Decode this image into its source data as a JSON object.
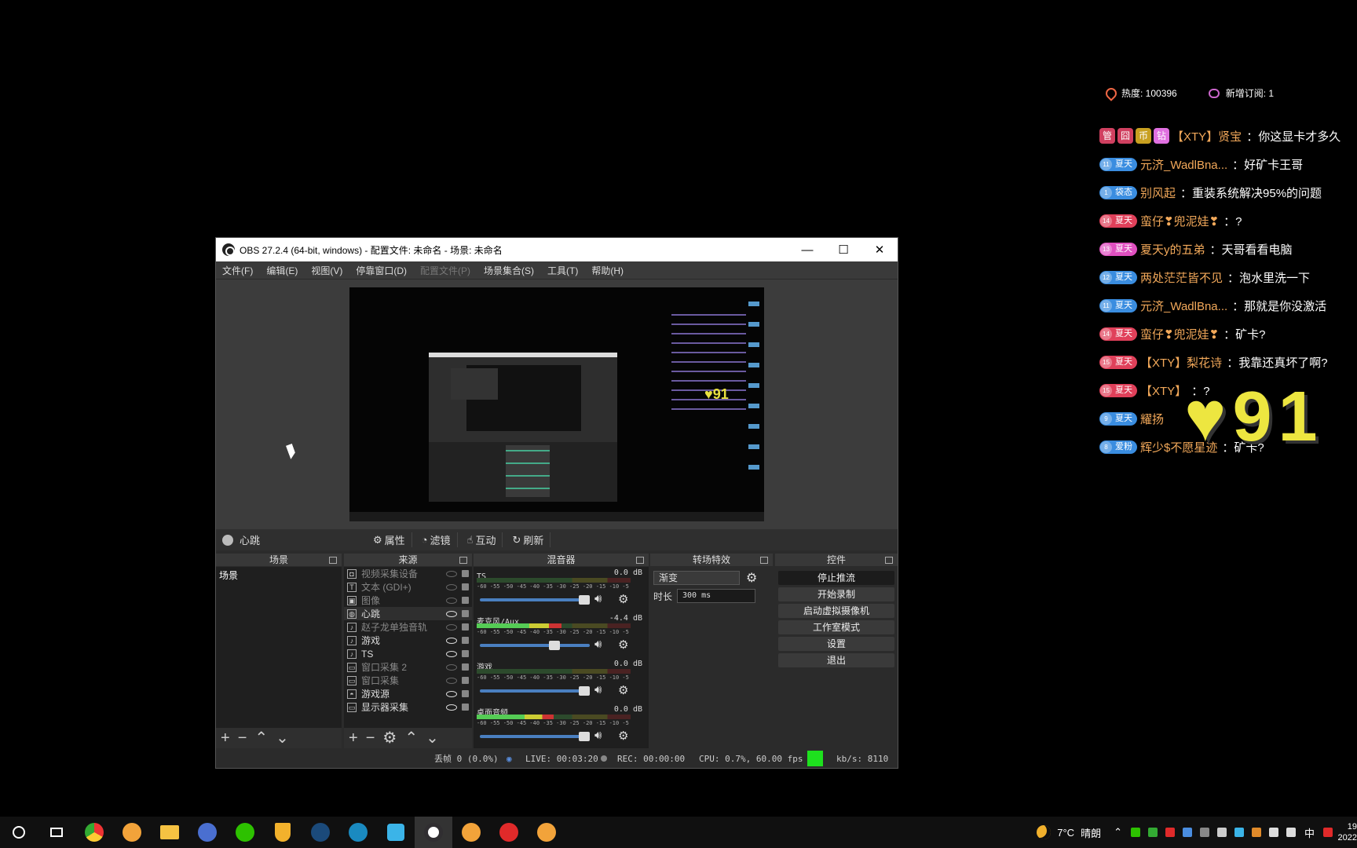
{
  "obs": {
    "title": "OBS 27.2.4 (64-bit, windows) - 配置文件: 未命名 - 场景: 未命名",
    "window_controls": {
      "minimize": "—",
      "maximize": "☐",
      "close": "✕"
    },
    "menu": [
      "文件(F)",
      "编辑(E)",
      "视图(V)",
      "停靠窗口(D)",
      "配置文件(P)",
      "场景集合(S)",
      "工具(T)",
      "帮助(H)"
    ],
    "source_bar": {
      "current_source": "心跳",
      "properties": "属性",
      "filters": "滤镜",
      "interact": "互动",
      "refresh": "刷新"
    },
    "docks": {
      "scenes": {
        "title": "场景",
        "items": [
          "场景"
        ]
      },
      "sources": {
        "title": "来源",
        "items": [
          {
            "label": "视频采集设备",
            "icon": "camera-icon",
            "visible": false
          },
          {
            "label": "文本 (GDI+)",
            "icon": "text-icon",
            "visible": false
          },
          {
            "label": "图像",
            "icon": "image-icon",
            "visible": false
          },
          {
            "label": "心跳",
            "icon": "globe-icon",
            "visible": true
          },
          {
            "label": "赵子龙单独音轨",
            "icon": "speaker-icon",
            "visible": false
          },
          {
            "label": "游戏",
            "icon": "speaker-icon",
            "visible": true
          },
          {
            "label": "TS",
            "icon": "speaker-icon",
            "visible": true
          },
          {
            "label": "窗口采集 2",
            "icon": "window-icon",
            "visible": false
          },
          {
            "label": "窗口采集",
            "icon": "window-icon",
            "visible": false
          },
          {
            "label": "游戏源",
            "icon": "gamepad-icon",
            "visible": true
          },
          {
            "label": "显示器采集",
            "icon": "monitor-icon",
            "visible": true
          }
        ]
      },
      "mixer": {
        "title": "混音器",
        "channels": [
          {
            "name": "TS",
            "db": "0.0 dB",
            "level": 0,
            "volume": 1.0
          },
          {
            "name": "麦克风/Aux",
            "db": "-4.4 dB",
            "level": 0.55,
            "volume": 0.7
          },
          {
            "name": "游戏",
            "db": "0.0 dB",
            "level": 0,
            "volume": 1.0
          },
          {
            "name": "桌面音频",
            "db": "0.0 dB",
            "level": 0.5,
            "volume": 1.0
          }
        ],
        "ticks": "-60 -55 -50 -45 -40 -35 -30 -25 -20 -15 -10 -5 0"
      },
      "transitions": {
        "title": "转场特效",
        "selected": "渐变",
        "duration_label": "时长",
        "duration_value": "300 ms"
      },
      "controls": {
        "title": "控件",
        "buttons": [
          "停止推流",
          "开始录制",
          "启动虚拟摄像机",
          "工作室模式",
          "设置",
          "退出"
        ]
      }
    },
    "status": {
      "dropped": "丢帧 0 (0.0%)",
      "live": "LIVE: 00:03:20",
      "rec": "REC: 00:00:00",
      "cpu": "CPU: 0.7%, 60.00 fps",
      "kbps": "kb/s: 8110"
    }
  },
  "chat": {
    "heat": "热度: 100396",
    "subs": "新增订阅: 1",
    "messages": [
      {
        "badge": "",
        "badge_color": "",
        "user": "【XTY】贤宝",
        "text": "：你这显卡才多久",
        "extra": [
          "管",
          "囧",
          "币",
          "钻"
        ]
      },
      {
        "badge": "夏天",
        "level": "11",
        "badge_color": "b-blue",
        "user": "元济_WadlBna...",
        "text": "：好矿卡王哥"
      },
      {
        "badge": "袋态",
        "level": "1",
        "badge_color": "b-blue",
        "user": "别风起",
        "text": "：重装系统解决95%的问题"
      },
      {
        "badge": "夏天",
        "level": "14",
        "badge_color": "b-red",
        "user": "蛮仔❣兜泥娃❣",
        "text": "：?"
      },
      {
        "badge": "夏天",
        "level": "13",
        "badge_color": "b-pink",
        "user": "夏天y的五弟",
        "text": "：天哥看看电脑"
      },
      {
        "badge": "夏天",
        "level": "12",
        "badge_color": "b-blue",
        "user": "两处茫茫皆不见",
        "text": "：泡水里洗一下"
      },
      {
        "badge": "夏天",
        "level": "11",
        "badge_color": "b-blue",
        "user": "元济_WadlBna...",
        "text": "：那就是你没激活"
      },
      {
        "badge": "夏天",
        "level": "14",
        "badge_color": "b-red",
        "user": "蛮仔❣兜泥娃❣",
        "text": "：矿卡?"
      },
      {
        "badge": "夏天",
        "level": "15",
        "badge_color": "b-red",
        "user": "【XTY】梨花诗",
        "text": "：我靠还真坏了啊?"
      },
      {
        "badge": "夏天",
        "level": "15",
        "badge_color": "b-red",
        "user": "【XTY】",
        "text": "：?"
      },
      {
        "badge": "夏天",
        "level": "9",
        "badge_color": "b-blue",
        "user": "耀扬",
        "text": ""
      },
      {
        "badge": "爱粉",
        "level": "8",
        "badge_color": "b-blue",
        "user": "辉少$不愿星迹",
        "text": "：矿卡?"
      }
    ],
    "heart_counter": "♥91"
  },
  "taskbar": {
    "weather": "7°C",
    "weather_text": "晴朗",
    "ime": "中",
    "clock_time": "19",
    "clock_date": "2022",
    "apps": [
      "search-icon",
      "taskview-icon",
      "chrome-icon",
      "app-icon",
      "folder-icon",
      "app-icon",
      "wechat-icon",
      "shield-icon",
      "steam-icon",
      "app-icon",
      "app-icon",
      "obs-icon",
      "app-icon",
      "netease-music-icon",
      "app-icon"
    ]
  }
}
